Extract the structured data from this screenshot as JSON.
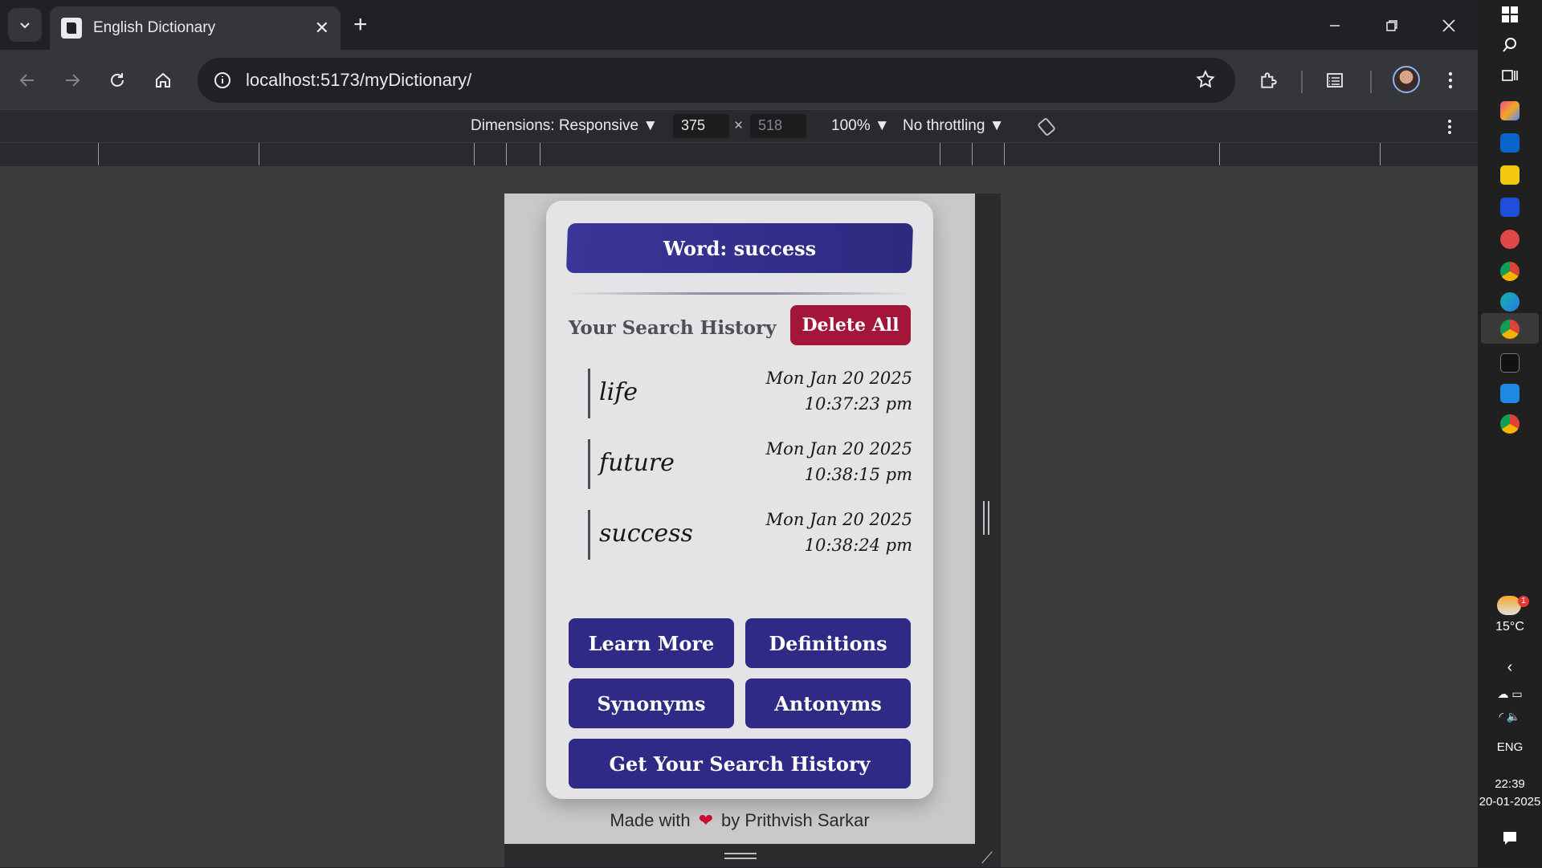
{
  "browser": {
    "tab_title": "English Dictionary",
    "url_host": "localhost",
    "url_rest": ":5173/myDictionary/"
  },
  "devtools": {
    "dimensions_label": "Dimensions: Responsive",
    "width": "375",
    "height": "518",
    "zoom": "100%",
    "throttling": "No throttling"
  },
  "app": {
    "word_banner": "Word: success",
    "history_heading": "Your Search History",
    "delete_all_label": "Delete All",
    "history": [
      {
        "word": "life",
        "date": "Mon Jan 20 2025",
        "time": "10:37:23 pm"
      },
      {
        "word": "future",
        "date": "Mon Jan 20 2025",
        "time": "10:38:15 pm"
      },
      {
        "word": "success",
        "date": "Mon Jan 20 2025",
        "time": "10:38:24 pm"
      }
    ],
    "buttons": {
      "learn_more": "Learn More",
      "definitions": "Definitions",
      "synonyms": "Synonyms",
      "antonyms": "Antonyms",
      "get_history": "Get Your Search History"
    },
    "footer_before": "Made with",
    "footer_after": "by Prithvish Sarkar"
  },
  "taskbar": {
    "weather_temp": "15°C",
    "weather_badge": "1",
    "language": "ENG",
    "time": "22:39",
    "date": "20-01-2025"
  },
  "colors": {
    "primary_button": "#2e2a85",
    "delete_button": "#a3163a",
    "card_bg": "#e4e4e6"
  }
}
